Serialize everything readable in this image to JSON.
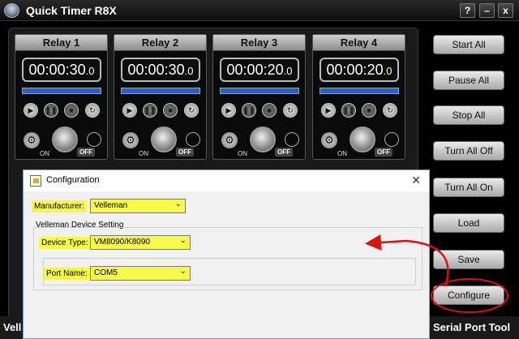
{
  "window": {
    "title": "Quick Timer R8X",
    "buttons": {
      "help": "?",
      "minimize": "–",
      "close": "x"
    }
  },
  "relays": [
    {
      "name": "Relay 1",
      "time": "00:00:30",
      "tenths": ".0",
      "on_label": "ON",
      "off_label": "OFF"
    },
    {
      "name": "Relay 2",
      "time": "00:00:30",
      "tenths": ".0",
      "on_label": "ON",
      "off_label": "OFF"
    },
    {
      "name": "Relay 3",
      "time": "00:00:20",
      "tenths": ".0",
      "on_label": "ON",
      "off_label": "OFF"
    },
    {
      "name": "Relay 4",
      "time": "00:00:20",
      "tenths": ".0",
      "on_label": "ON",
      "off_label": "OFF"
    }
  ],
  "sidebar": {
    "start_all": "Start All",
    "pause_all": "Pause All",
    "stop_all": "Stop All",
    "turn_all_off": "Turn All Off",
    "turn_all_on": "Turn All On",
    "load": "Load",
    "save": "Save",
    "configure": "Configure"
  },
  "statusbar": {
    "left": "Vell",
    "right": "Serial Port Tool"
  },
  "dialog": {
    "title": "Configuration",
    "manufacturer_label": "Manufacturer:",
    "manufacturer_value": "Velleman",
    "group_label": "Velleman Device Setting",
    "device_type_label": "Device Type:",
    "device_type_value": "VM8090/K8090",
    "port_name_label": "Port Name:",
    "port_name_value": "COM5",
    "close": "✕"
  },
  "colors": {
    "highlight": "#f6f84a",
    "annotation": "#dd1111",
    "progress": "#2f5fc6"
  }
}
